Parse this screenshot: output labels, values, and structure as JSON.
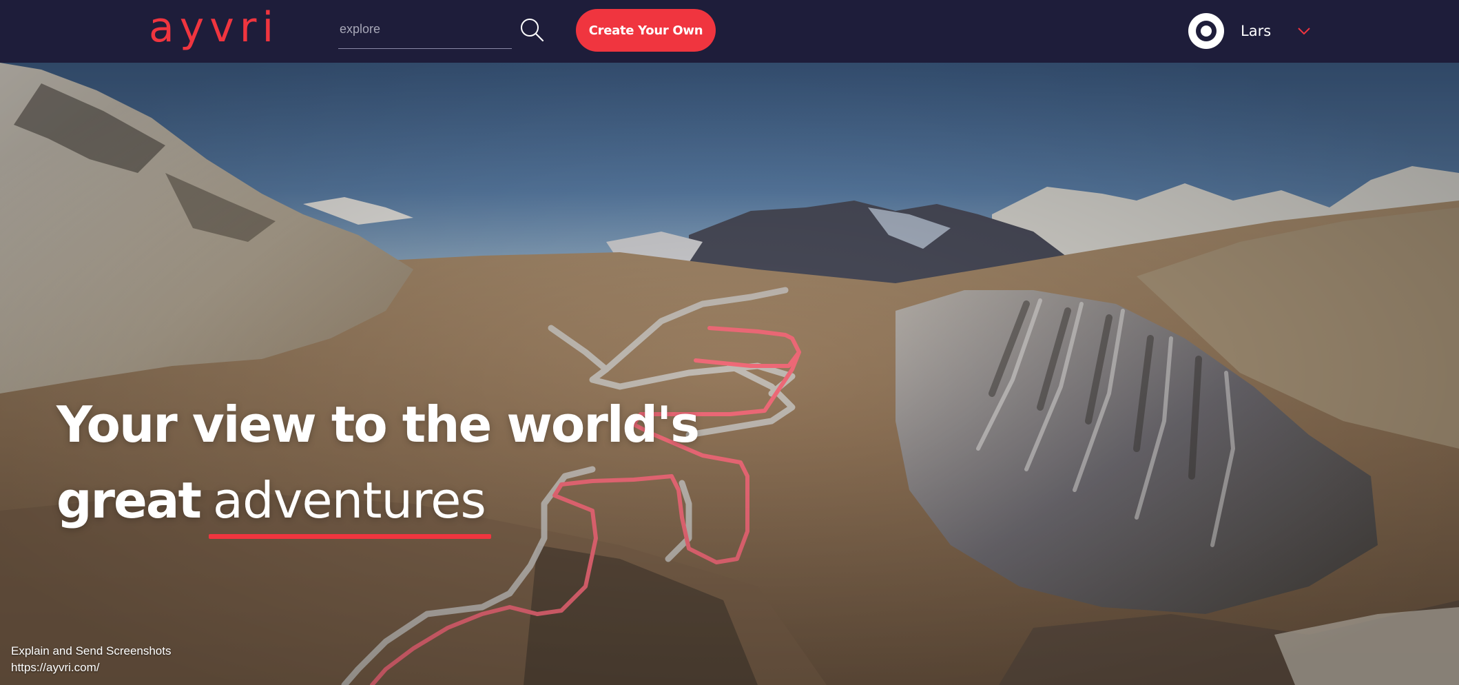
{
  "navbar": {
    "logo_text": "ayvri",
    "search": {
      "placeholder": "explore",
      "value": ""
    },
    "create_button_label": "Create Your Own",
    "user": {
      "name": "Lars"
    }
  },
  "hero": {
    "headline_line1": "Your view to the world's",
    "headline_bold": "great",
    "headline_light": "adventures"
  },
  "footer": {
    "line1": "Explain and Send Screenshots",
    "line2": "https://ayvri.com/"
  },
  "colors": {
    "navbar_bg": "#1e1d3a",
    "accent": "#f0353f",
    "route": "#f06070"
  },
  "icons": {
    "search": "search-icon",
    "avatar": "avatar-icon",
    "dropdown": "chevron-down-icon"
  }
}
